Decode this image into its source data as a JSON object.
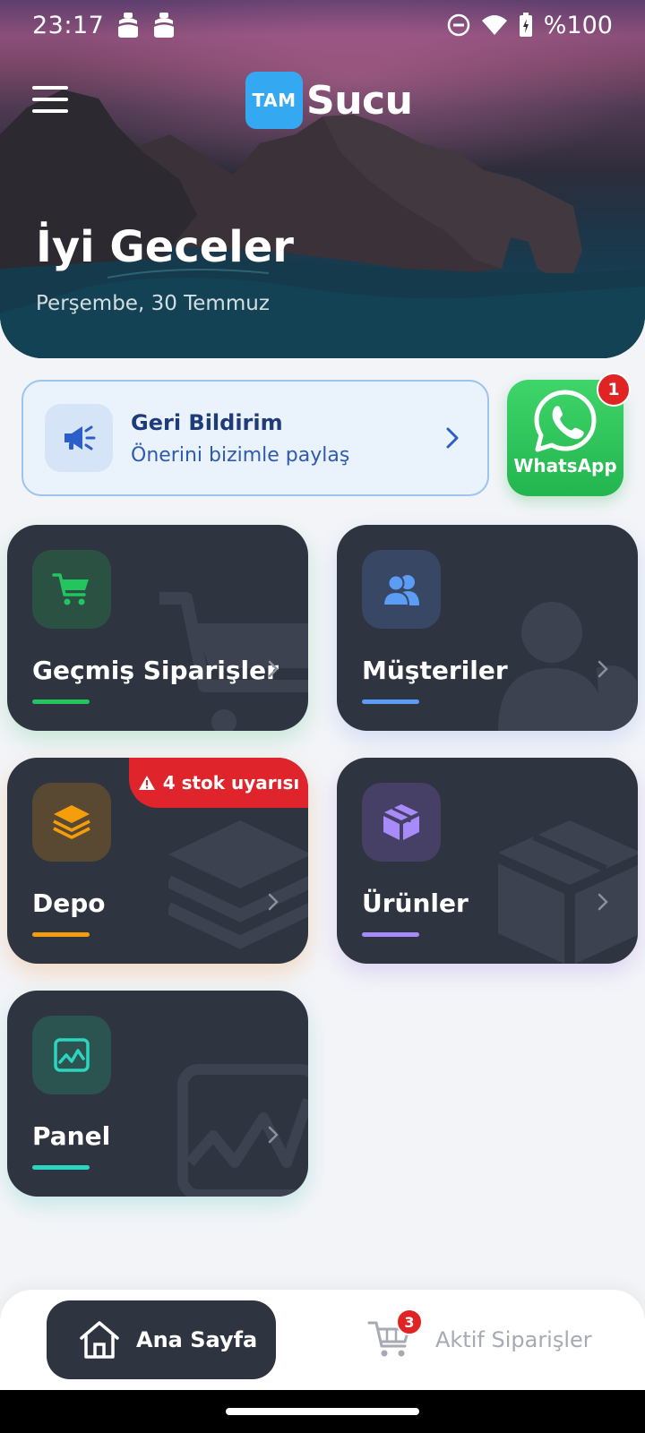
{
  "status_bar": {
    "time": "23:17",
    "battery": "%100"
  },
  "header": {
    "logo_badge": "TAM",
    "logo_text": "Sucu",
    "greeting": "İyi Geceler",
    "date": "Perşembe, 30 Temmuz"
  },
  "feedback": {
    "title": "Geri Bildirim",
    "subtitle": "Önerini bizimle paylaş"
  },
  "whatsapp": {
    "label": "WhatsApp",
    "badge": "1"
  },
  "tiles": [
    {
      "label": "Geçmiş Siparişler",
      "icon": "cart-icon",
      "accent": "#22c55e"
    },
    {
      "label": "Müşteriler",
      "icon": "users-icon",
      "accent": "#5b9cf5"
    },
    {
      "label": "Depo",
      "icon": "layers-icon",
      "accent": "#f59e0b",
      "alert": "4 stok uyarısı"
    },
    {
      "label": "Ürünler",
      "icon": "box-icon",
      "accent": "#a78bfa"
    },
    {
      "label": "Panel",
      "icon": "chart-icon",
      "accent": "#2dd4bf"
    }
  ],
  "bottom_nav": {
    "home_label": "Ana Sayfa",
    "orders_label": "Aktif Siparişler",
    "orders_badge": "3"
  }
}
